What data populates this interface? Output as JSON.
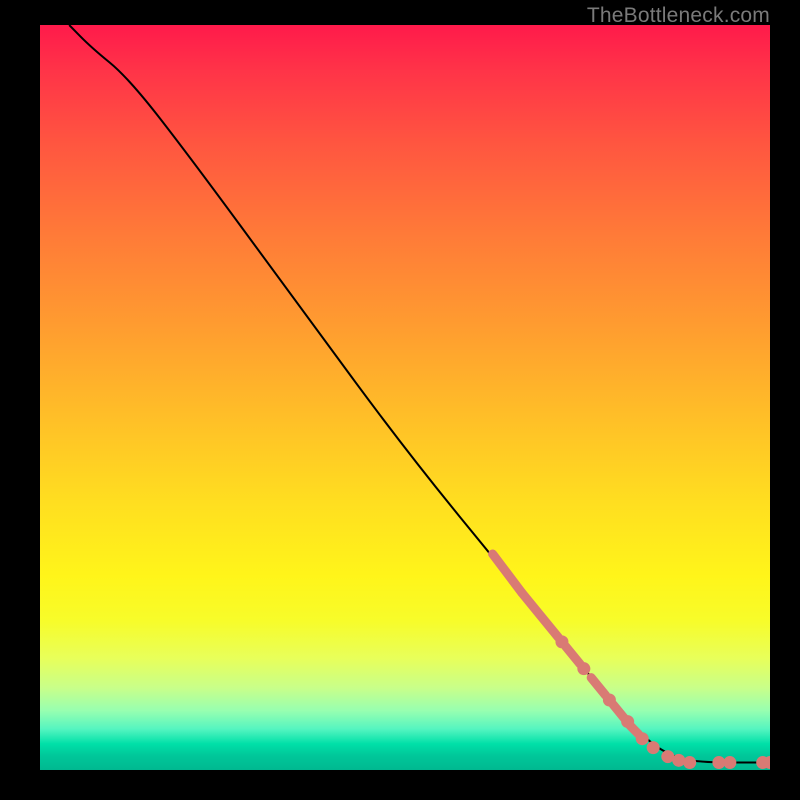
{
  "watermark": "TheBottleneck.com",
  "chart_data": {
    "type": "line",
    "title": "",
    "xlabel": "",
    "ylabel": "",
    "xlim": [
      0,
      100
    ],
    "ylim": [
      0,
      100
    ],
    "curve": [
      {
        "x": 4,
        "y": 100
      },
      {
        "x": 7,
        "y": 97
      },
      {
        "x": 12,
        "y": 93
      },
      {
        "x": 20,
        "y": 83
      },
      {
        "x": 35,
        "y": 63
      },
      {
        "x": 50,
        "y": 43
      },
      {
        "x": 65,
        "y": 25
      },
      {
        "x": 75,
        "y": 13
      },
      {
        "x": 82,
        "y": 5
      },
      {
        "x": 86,
        "y": 2
      },
      {
        "x": 90,
        "y": 1
      },
      {
        "x": 100,
        "y": 1
      }
    ],
    "highlight_segments": [
      {
        "x0": 62,
        "y0": 29.0,
        "x1": 66,
        "y1": 23.8,
        "w": 9
      },
      {
        "x0": 66,
        "y0": 23.8,
        "x1": 71,
        "y1": 17.8,
        "w": 9
      },
      {
        "x0": 72,
        "y0": 16.6,
        "x1": 74,
        "y1": 14.2,
        "w": 9
      },
      {
        "x0": 75.5,
        "y0": 12.4,
        "x1": 77.5,
        "y1": 10.0,
        "w": 9
      },
      {
        "x0": 78.5,
        "y0": 8.8,
        "x1": 80.0,
        "y1": 7.0,
        "w": 9
      },
      {
        "x0": 80.8,
        "y0": 6.0,
        "x1": 82.0,
        "y1": 4.8,
        "w": 9
      }
    ],
    "highlight_dots": [
      {
        "x": 71.5,
        "y": 17.2
      },
      {
        "x": 74.5,
        "y": 13.6
      },
      {
        "x": 78.0,
        "y": 9.4
      },
      {
        "x": 80.5,
        "y": 6.5
      },
      {
        "x": 82.5,
        "y": 4.2
      },
      {
        "x": 84.0,
        "y": 3.0
      },
      {
        "x": 86.0,
        "y": 1.8
      },
      {
        "x": 87.5,
        "y": 1.3
      },
      {
        "x": 89.0,
        "y": 1.0
      },
      {
        "x": 93.0,
        "y": 1.0
      },
      {
        "x": 94.5,
        "y": 1.0
      },
      {
        "x": 99.0,
        "y": 1.0
      },
      {
        "x": 100.0,
        "y": 1.0
      }
    ],
    "highlight_color": "#d97a74",
    "dot_radius": 6.5
  }
}
